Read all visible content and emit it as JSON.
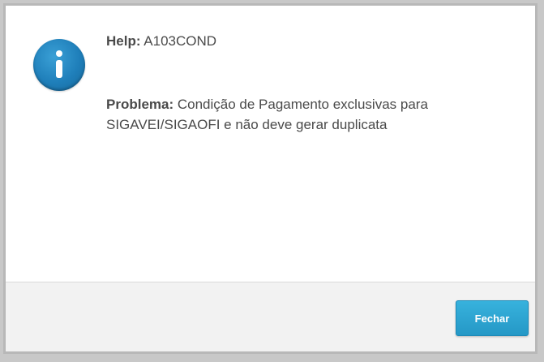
{
  "dialog": {
    "icon": "info-icon",
    "help_label": "Help:",
    "help_code": "A103COND",
    "problem_label": "Problema:",
    "problem_text": "Condição de Pagamento exclusivas para SIGAVEI/SIGAOFI e não deve gerar duplicata",
    "close_button_label": "Fechar"
  },
  "colors": {
    "accent": "#2598c6",
    "icon_blue": "#1f7fba",
    "text": "#4a4a4a",
    "footer_bg": "#f2f2f2"
  }
}
